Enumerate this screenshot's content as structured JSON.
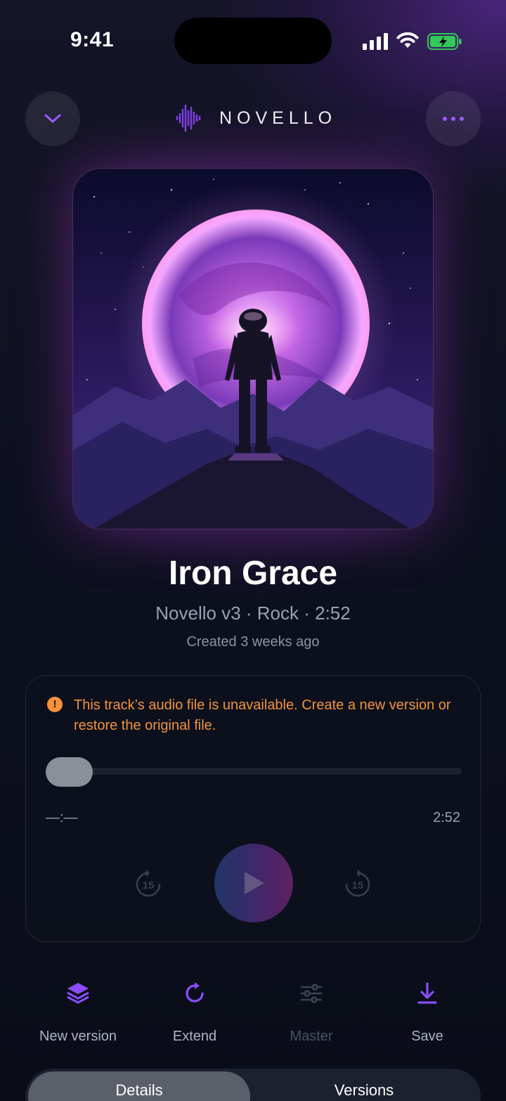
{
  "status_bar": {
    "time": "9:41"
  },
  "header": {
    "logo_text": "NOVELLO",
    "collapse_icon": "chevron-down-icon",
    "more_icon": "more-horizontal-icon"
  },
  "track": {
    "title": "Iron Grace",
    "meta": "Novello v3 · Rock · 2:52",
    "created": "Created 3 weeks ago"
  },
  "player": {
    "warning": "This track’s audio file is unavailable. Create a new version or restore the original file.",
    "elapsed": "—:—",
    "duration": "2:52",
    "skip_back_label": "15",
    "skip_forward_label": "15",
    "progress": 0
  },
  "actions": [
    {
      "label": "New version",
      "icon": "layers-icon",
      "enabled": true
    },
    {
      "label": "Extend",
      "icon": "refresh-icon",
      "enabled": true
    },
    {
      "label": "Master",
      "icon": "sliders-icon",
      "enabled": false
    },
    {
      "label": "Save",
      "icon": "download-icon",
      "enabled": true
    }
  ],
  "tabs": [
    {
      "label": "Details",
      "active": true
    },
    {
      "label": "Versions",
      "active": false
    }
  ],
  "colors": {
    "accent": "#8b4dff",
    "warning": "#f5923a",
    "battery": "#34c759"
  }
}
